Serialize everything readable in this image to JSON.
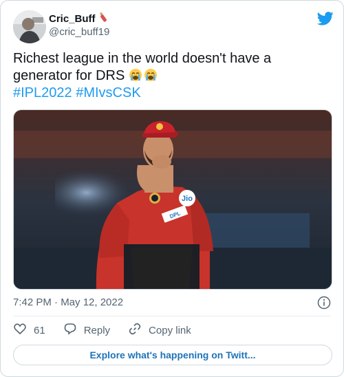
{
  "user": {
    "name": "Cric_Buff",
    "handle": "@cric_buff19",
    "badge_icon": "cricket-bat-icon"
  },
  "tweet": {
    "text": "Richest league in the world doesn't have a generator for DRS",
    "emojis": [
      "loudly-crying-face-icon",
      "loudly-crying-face-icon"
    ],
    "hashtags": [
      "#IPL2022",
      "#MIvsCSK"
    ],
    "timestamp": "7:42 PM · May 12, 2022"
  },
  "media": {
    "description_icon": "photo",
    "jersey_sponsor": "Jio",
    "jersey_badge": "DPL"
  },
  "actions": {
    "like_count": "61",
    "reply_label": "Reply",
    "copy_label": "Copy link"
  },
  "explore_label": "Explore what's happening on Twitt...",
  "colors": {
    "brand_blue": "#1d9bf0",
    "text_primary": "#0f1419",
    "text_secondary": "#536471",
    "border": "#cfd9de"
  }
}
